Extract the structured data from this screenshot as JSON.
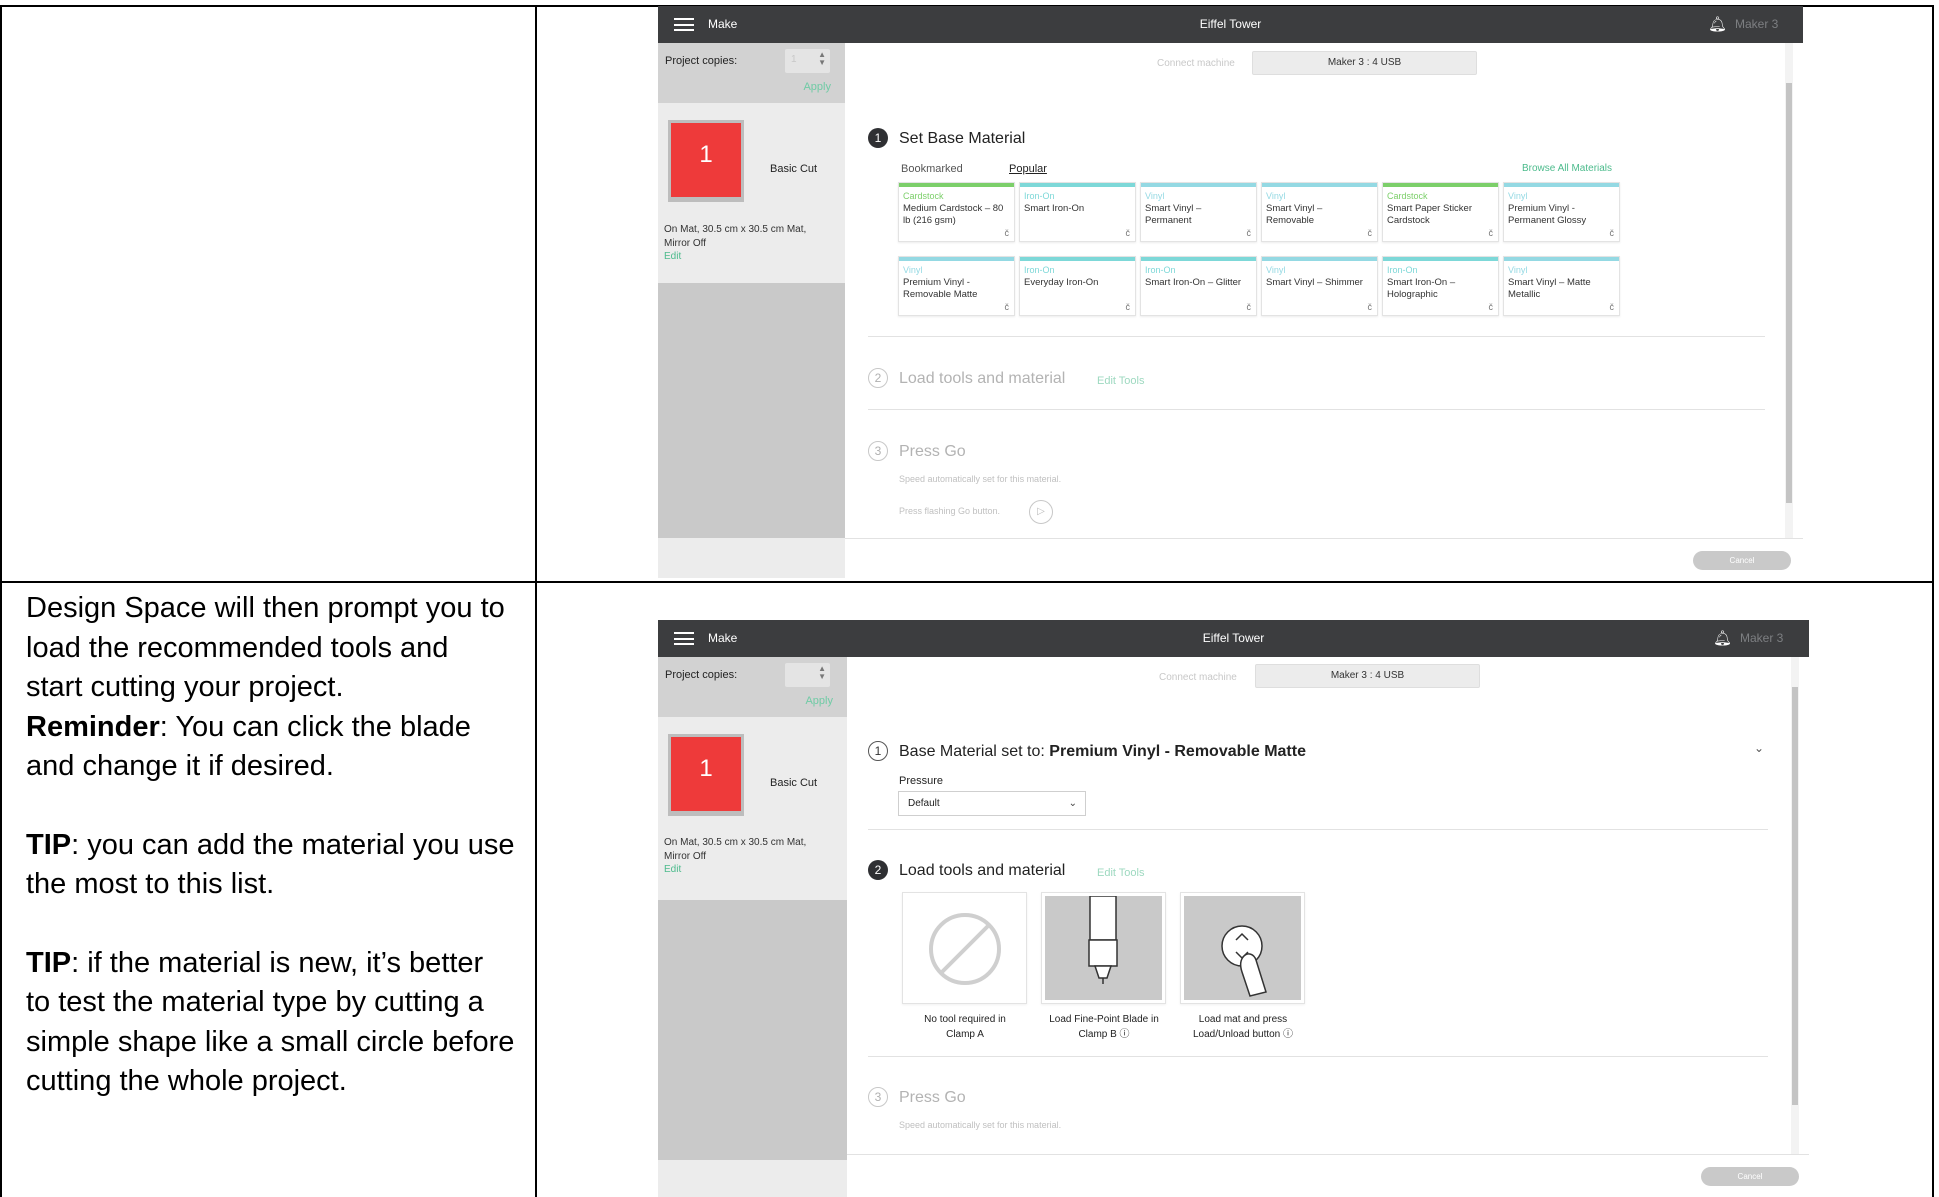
{
  "instructions": {
    "line1": "Design Space will then prompt you to",
    "line2": "load the recommended tools and",
    "line3": "start cutting your project.",
    "reminder_label": "Reminder",
    "reminder_line1": ": You can click the blade",
    "reminder_line2": "and change it if desired.",
    "tip1_label": "TIP",
    "tip1_line1": ": you can add the material you use",
    "tip1_line2": "the most to this list.",
    "tip2_label": "TIP",
    "tip2_line1": ": if the material is new, it’s better",
    "tip2_line2": "to test the material type by cutting a",
    "tip2_line3": "simple shape like a small circle before",
    "tip2_line4": "cutting the whole project."
  },
  "screen1": {
    "header": {
      "menu_label": "Make",
      "title": "Eiffel Tower",
      "machine": "Maker 3"
    },
    "sidebar": {
      "copies_label": "Project copies:",
      "copies_value": "1",
      "apply": "Apply",
      "mat_number": "1",
      "cut_type": "Basic Cut",
      "mat_info_1": "On Mat, 30.5 cm x 30.5 cm Mat,",
      "mat_info_2": "Mirror Off",
      "edit": "Edit"
    },
    "connect_label": "Connect machine",
    "machine_select": "Maker 3 : 4 USB",
    "step1": {
      "number": "1",
      "title": "Set Base Material"
    },
    "tabs": {
      "bookmarked": "Bookmarked",
      "popular": "Popular"
    },
    "browse_all": "Browse All Materials",
    "colors": {
      "cardstock": "#7ccf6a",
      "ironon": "#7dd8d8",
      "vinyl": "#94d9e3"
    },
    "materials_row1": [
      {
        "category": "Cardstock",
        "name": "Medium Cardstock – 80 lb (216 gsm)",
        "kind": "cardstock"
      },
      {
        "category": "Iron-On",
        "name": "Smart Iron-On",
        "kind": "ironon"
      },
      {
        "category": "Vinyl",
        "name": "Smart Vinyl – Permanent",
        "kind": "vinyl"
      },
      {
        "category": "Vinyl",
        "name": "Smart Vinyl – Removable",
        "kind": "vinyl"
      },
      {
        "category": "Cardstock",
        "name": "Smart Paper Sticker Cardstock",
        "kind": "cardstock"
      },
      {
        "category": "Vinyl",
        "name": "Premium Vinyl - Permanent Glossy",
        "kind": "vinyl"
      }
    ],
    "materials_row2": [
      {
        "category": "Vinyl",
        "name": "Premium Vinyl - Removable Matte",
        "kind": "vinyl"
      },
      {
        "category": "Iron-On",
        "name": "Everyday Iron-On",
        "kind": "ironon"
      },
      {
        "category": "Iron-On",
        "name": "Smart Iron-On – Glitter",
        "kind": "ironon"
      },
      {
        "category": "Vinyl",
        "name": "Smart Vinyl – Shimmer",
        "kind": "vinyl"
      },
      {
        "category": "Iron-On",
        "name": "Smart Iron-On – Holographic",
        "kind": "ironon"
      },
      {
        "category": "Vinyl",
        "name": "Smart Vinyl – Matte Metallic",
        "kind": "vinyl"
      }
    ],
    "card_mark": "č",
    "step2": {
      "number": "2",
      "title": "Load tools and material",
      "edit_tools": "Edit Tools"
    },
    "step3": {
      "number": "3",
      "title": "Press Go",
      "speed_note": "Speed automatically set for this material.",
      "press_note": "Press flashing Go button."
    },
    "cancel": "Cancel"
  },
  "screen2": {
    "header": {
      "menu_label": "Make",
      "title": "Eiffel Tower",
      "machine": "Maker 3"
    },
    "sidebar": {
      "copies_label": "Project copies:",
      "apply": "Apply",
      "mat_number": "1",
      "cut_type": "Basic Cut",
      "mat_info_1": "On Mat, 30.5 cm x 30.5 cm Mat,",
      "mat_info_2": "Mirror Off",
      "edit": "Edit"
    },
    "connect_label": "Connect machine",
    "machine_select": "Maker 3 : 4 USB",
    "step1": {
      "number": "1",
      "label": "Base Material set to:",
      "material": "Premium Vinyl - Removable Matte"
    },
    "pressure_label": "Pressure",
    "pressure_value": "Default",
    "step2": {
      "number": "2",
      "title": "Load tools and material",
      "edit_tools": "Edit Tools"
    },
    "tools": [
      {
        "caption_1": "No tool required in",
        "caption_2": "Clamp A"
      },
      {
        "caption_1": "Load Fine-Point Blade in",
        "caption_2": "Clamp B ⓘ"
      },
      {
        "caption_1": "Load mat and press",
        "caption_2": "Load/Unload button ⓘ"
      }
    ],
    "step3": {
      "number": "3",
      "title": "Press Go",
      "speed_note": "Speed automatically set for this material."
    },
    "cancel": "Cancel"
  }
}
